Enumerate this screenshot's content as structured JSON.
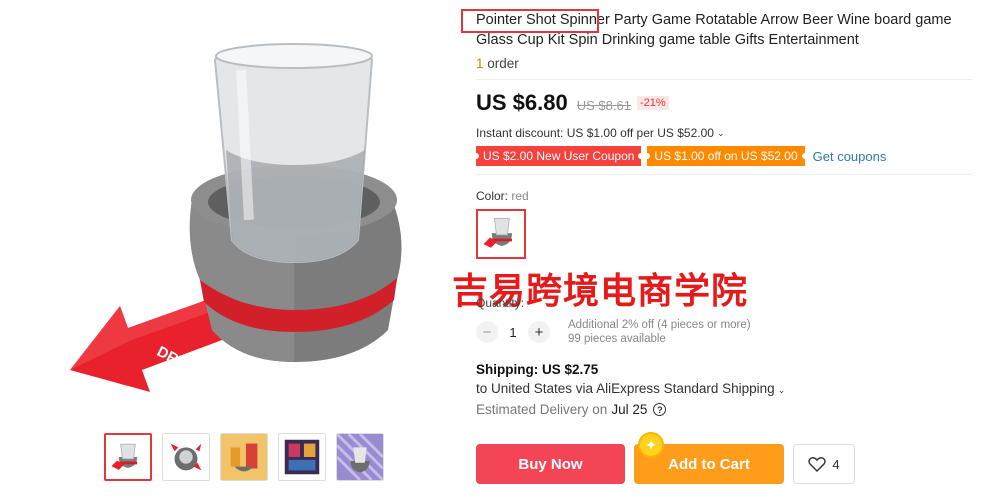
{
  "product": {
    "title_highlight": "Pointer Shot Spinner",
    "title_rest": " Party Game Rotatable Arrow Beer Wine board game Glass Cup Kit Spin Drinking game table Gifts Entertainment",
    "orders_count": "1",
    "orders_label": " order",
    "arrow_text": "DRINK"
  },
  "price": {
    "current": "US $6.80",
    "original": "US $8.61",
    "discount": "-21%"
  },
  "instant_discount": "Instant discount: US $1.00 off per US $52.00",
  "coupons": [
    "US $2.00 New User Coupon",
    "US $1.00 off on US $52.00"
  ],
  "get_coupons": "Get coupons",
  "color": {
    "label": "Color: ",
    "value": "red"
  },
  "watermark": "吉易跨境电商学院",
  "quantity": {
    "label": "Quantity:",
    "value": "1",
    "minus": "−",
    "plus": "+",
    "note1": "Additional 2% off (4 pieces or more)",
    "note2": "99 pieces available"
  },
  "shipping": {
    "title": "Shipping: US $2.75",
    "line": "to United States via AliExpress Standard Shipping",
    "delivery_label": "Estimated Delivery on",
    "delivery_date": "Jul 25"
  },
  "actions": {
    "buy_now": "Buy Now",
    "add_to_cart": "Add to Cart",
    "wishlist_count": "4"
  },
  "colors": {
    "accent_red": "#f44557",
    "accent_orange": "#ff9c1a",
    "coupon_red": "#f5423c",
    "coupon_orange": "#ff8a00",
    "link_blue": "#2d7ab5"
  },
  "icons": [
    "chevron-down-icon",
    "help-icon",
    "heart-icon",
    "coin-icon"
  ]
}
